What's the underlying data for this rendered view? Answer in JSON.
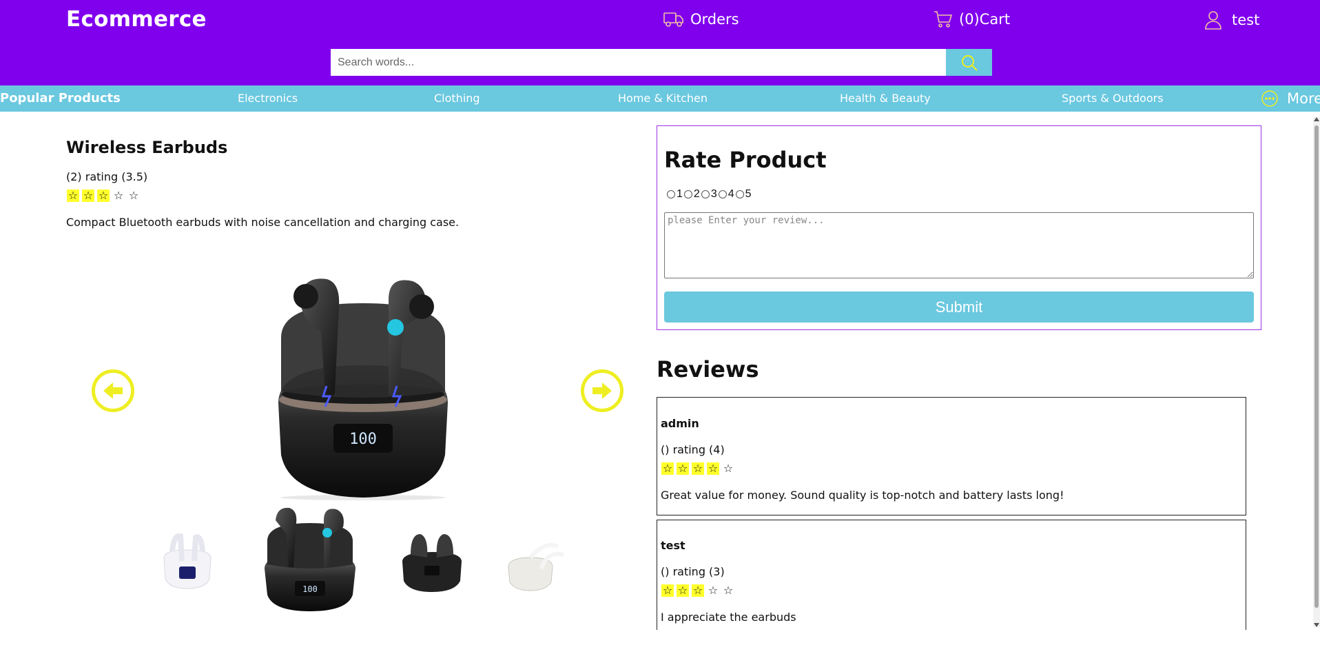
{
  "header": {
    "brand": "Ecommerce",
    "orders_label": "Orders",
    "cart_label": "(0)Cart",
    "user_label": "test",
    "search_placeholder": "Search words..."
  },
  "categories": {
    "popular": "Popular Products",
    "items": [
      "Electronics",
      "Clothing",
      "Home & Kitchen",
      "Health & Beauty",
      "Sports & Outdoors"
    ],
    "more": "More"
  },
  "product": {
    "title": "Wireless Earbuds",
    "rating_text": "(2) rating (3.5)",
    "stars_filled": 3,
    "stars_total": 5,
    "description": "Compact Bluetooth earbuds with noise cancellation and charging case."
  },
  "rate": {
    "title": "Rate Product",
    "options": [
      "1",
      "2",
      "3",
      "4",
      "5"
    ],
    "placeholder": "please Enter your review...",
    "submit_label": "Submit"
  },
  "reviews": {
    "title": "Reviews",
    "items": [
      {
        "name": "admin",
        "rating_text": "() rating (4)",
        "stars_filled": 4,
        "text": "Great value for money. Sound quality is top-notch and battery lasts long!"
      },
      {
        "name": "test",
        "rating_text": "() rating (3)",
        "stars_filled": 3,
        "text": "I appreciate the earbuds"
      }
    ]
  },
  "colors": {
    "header_bg": "#8000ee",
    "accent": "#6ac8df",
    "arrow": "#eeee22",
    "star_fill": "#ffff2a"
  }
}
